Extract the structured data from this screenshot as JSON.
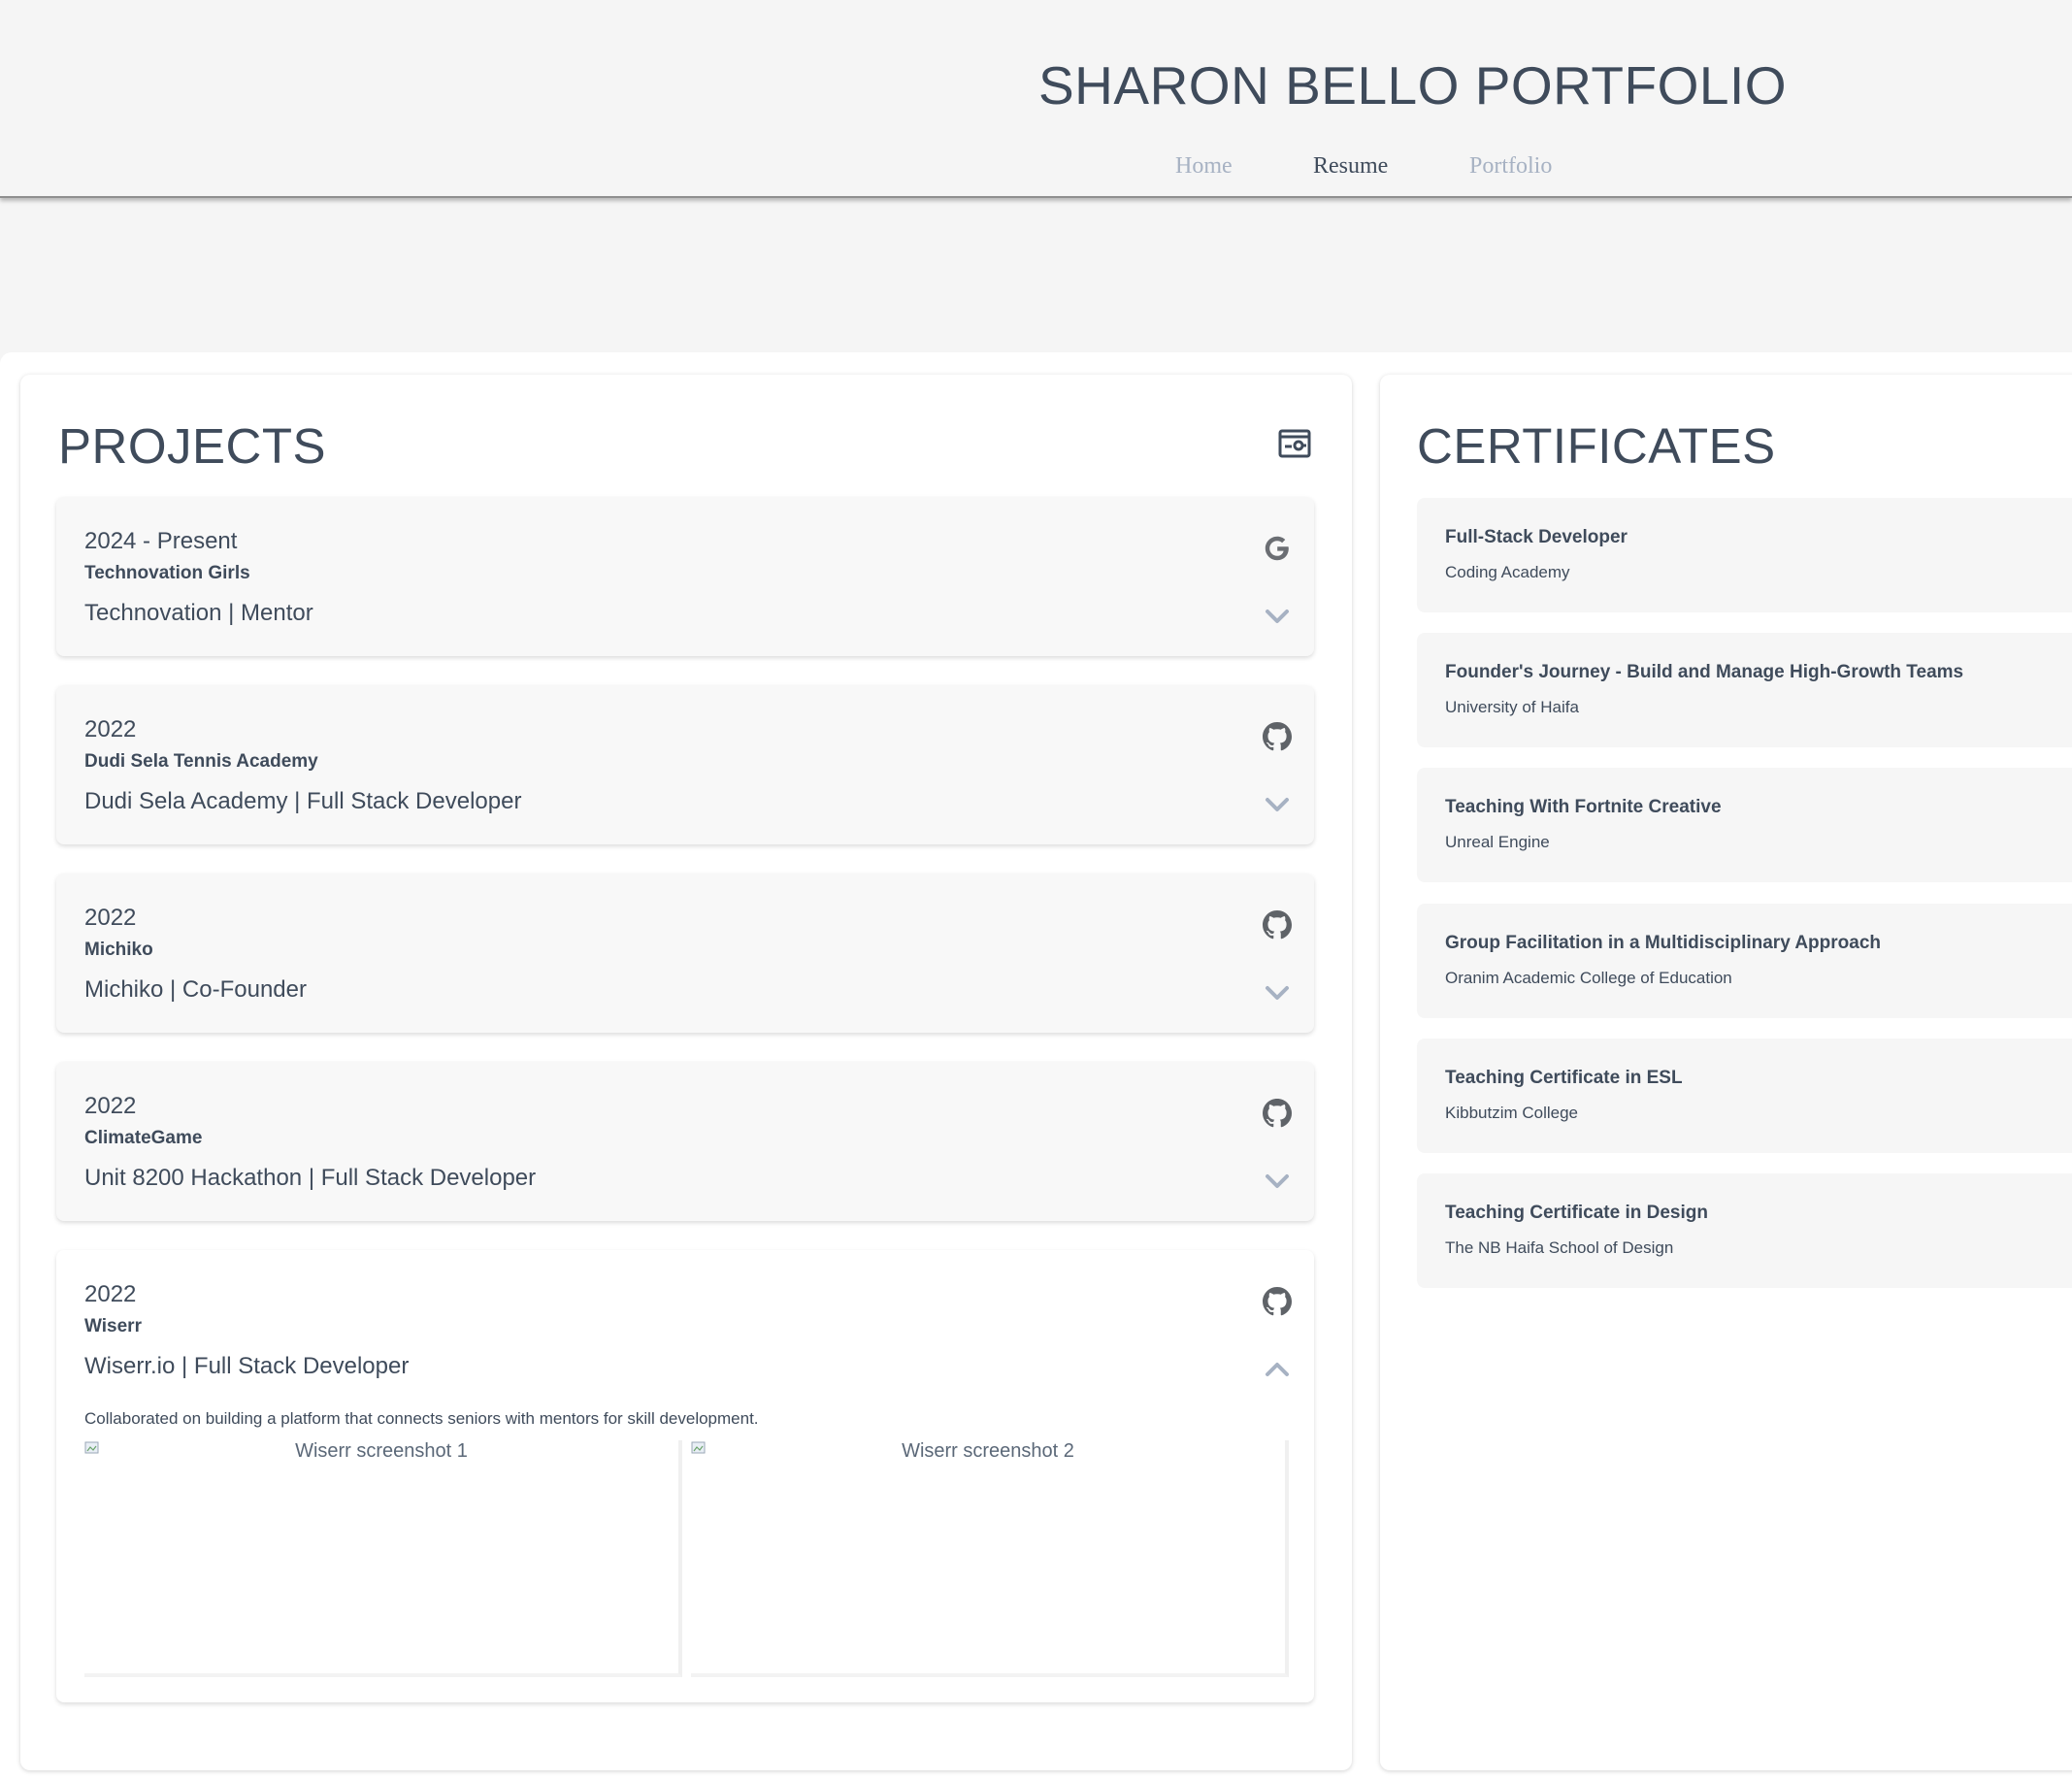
{
  "header": {
    "title": "SHARON BELLO PORTFOLIO",
    "nav": [
      {
        "label": "Home",
        "active": false
      },
      {
        "label": "Resume",
        "active": true
      },
      {
        "label": "Portfolio",
        "active": false
      }
    ]
  },
  "projects": {
    "title": "PROJECTS",
    "header_icon": "resume-card-icon",
    "items": [
      {
        "year": "2024 - Present",
        "name": "Technovation Girls",
        "role": "Technovation | Mentor",
        "link_icon": "google-icon",
        "expanded": false
      },
      {
        "year": "2022",
        "name": "Dudi Sela Tennis Academy",
        "role": "Dudi Sela Academy | Full Stack Developer",
        "link_icon": "github-icon",
        "expanded": false
      },
      {
        "year": "2022",
        "name": "Michiko",
        "role": "Michiko | Co-Founder",
        "link_icon": "github-icon",
        "expanded": false
      },
      {
        "year": "2022",
        "name": "ClimateGame",
        "role": "Unit 8200 Hackathon | Full Stack Developer",
        "link_icon": "github-icon",
        "expanded": false
      },
      {
        "year": "2022",
        "name": "Wiserr",
        "role": "Wiserr.io | Full Stack Developer",
        "link_icon": "github-icon",
        "expanded": true,
        "description": "Collaborated on building a platform that connects seniors with mentors for skill development.",
        "screenshots": [
          "Wiserr screenshot 1",
          "Wiserr screenshot 2"
        ]
      }
    ]
  },
  "certificates": {
    "title": "CERTIFICATES",
    "items": [
      {
        "title": "Full-Stack Developer",
        "issuer": "Coding Academy"
      },
      {
        "title": "Founder's Journey - Build and Manage High-Growth Teams",
        "issuer": "University of Haifa"
      },
      {
        "title": "Teaching With Fortnite Creative",
        "issuer": "Unreal Engine"
      },
      {
        "title": "Group Facilitation in a Multidisciplinary Approach",
        "issuer": "Oranim Academic College of Education"
      },
      {
        "title": "Teaching Certificate in ESL",
        "issuer": "Kibbutzim College"
      },
      {
        "title": "Teaching Certificate in Design",
        "issuer": "The NB Haifa School of Design"
      }
    ]
  },
  "colors": {
    "text": "#3f4b5b",
    "nav_inactive": "#a7b2c3",
    "chevron": "#a7b2c3",
    "icon": "#5f6368",
    "background": "#f5f5f5",
    "card": "#f8f8f8"
  }
}
